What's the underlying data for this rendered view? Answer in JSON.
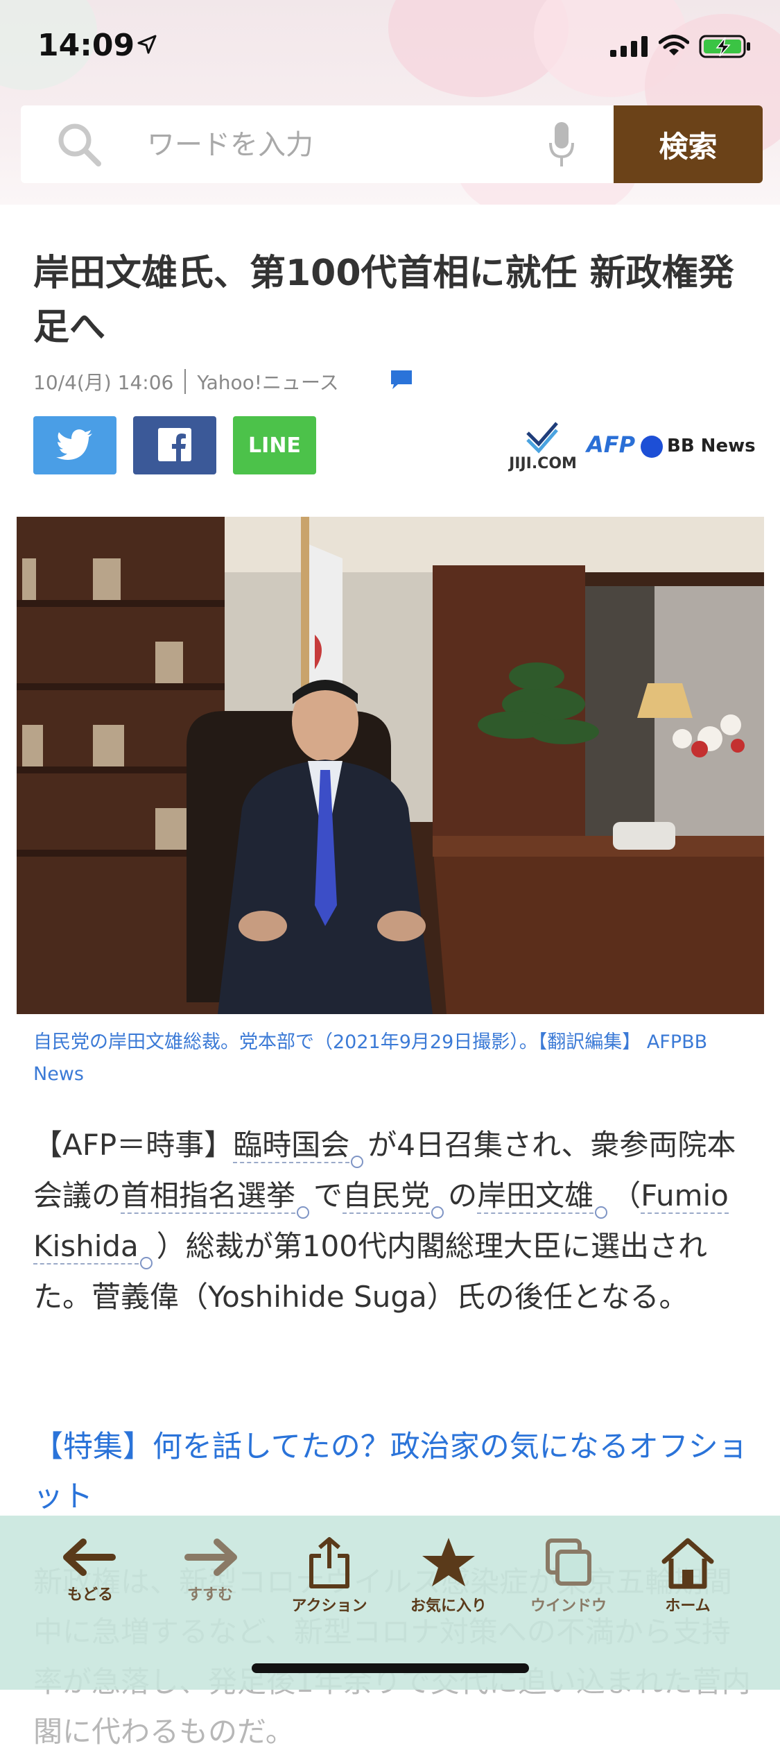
{
  "status_bar": {
    "time": "14:09"
  },
  "search": {
    "placeholder": "ワードを入力",
    "button_label": "検索"
  },
  "article": {
    "title": "岸田文雄氏、第100代首相に就任 新政権発足へ",
    "date": "10/4(月) 14:06",
    "source": "Yahoo!ニュース",
    "share": {
      "twitter": "twitter-icon",
      "facebook": "facebook-icon",
      "line": "LINE"
    },
    "partners": {
      "jiji": "JIJI.COM",
      "afp": "AFP",
      "bbnews": "BB News"
    },
    "caption": "自民党の岸田文雄総裁。党本部で（2021年9月29日撮影）。【翻訳編集】 AFPBB News",
    "body": {
      "p1_a": "【AFP＝時事】",
      "kw1": "臨時国会",
      "p1_b": "が4日召集され、衆参両院本会議の",
      "kw2": "首相指名選挙",
      "p1_c": "で",
      "kw3": "自民党",
      "p1_d": "の",
      "kw4": "岸田文雄",
      "p1_e": "（",
      "kw5": "Fumio Kishida",
      "p1_f": "）総裁が第100代内閣総理大臣に選出された。菅義偉（Yoshihide Suga）氏の後任となる。"
    },
    "feature_link": "【特集】何を話してたの？政治家の気になるオフショット",
    "next_paragraph": "新政権は、新型コロナウイルス感染症が東京五輪期間中に急増するなど、新型コロナ対策への不満から支持率が急落し、発足後1年余りで交代に追い込まれた菅内閣に代わるものだ。"
  },
  "toolbar": {
    "back": "もどる",
    "forward": "すすむ",
    "action": "アクション",
    "favorites": "お気に入り",
    "window": "ウインドウ",
    "home": "ホーム"
  },
  "colors": {
    "search_button": "#6b4218",
    "link": "#2a73d9",
    "toolbar_bg": "#c7e6dd"
  }
}
